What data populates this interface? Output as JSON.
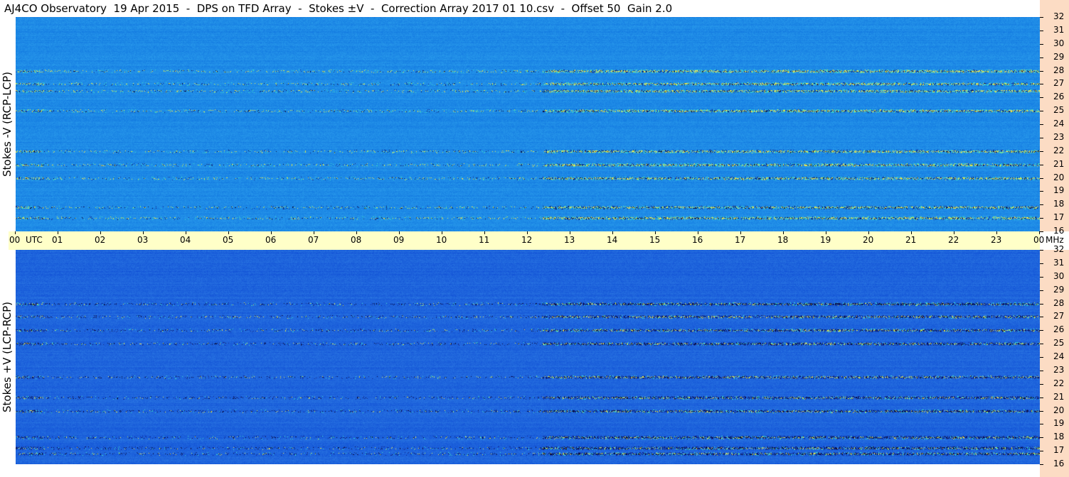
{
  "title": "AJ4CO Observatory  19 Apr 2015  -  DPS on TFD Array  -  Stokes ±V  -  Correction Array 2017 01 10.csv  -  Offset 50  Gain 2.0",
  "panels": [
    {
      "label": "Stokes -V (RCP-LCP)"
    },
    {
      "label": "Stokes +V (LCP-RCP)"
    }
  ],
  "colors": {
    "axis_bg": "#fcdcc4",
    "time_bar_bg": "#ffffc8",
    "panel_top_base": "#1e8ae6",
    "panel_bottom_base": "#1e64dc"
  },
  "chart_data": [
    {
      "type": "heatmap",
      "title": "Stokes -V (RCP-LCP)",
      "x_axis": {
        "unit": "UTC",
        "ticks": [
          "00",
          "01",
          "02",
          "03",
          "04",
          "05",
          "06",
          "07",
          "08",
          "09",
          "10",
          "11",
          "12",
          "13",
          "14",
          "15",
          "16",
          "17",
          "18",
          "19",
          "20",
          "21",
          "22",
          "23",
          "00"
        ],
        "range": [
          0,
          24
        ]
      },
      "y_axis": {
        "unit": "MHz",
        "ticks": [
          "16",
          "17",
          "18",
          "19",
          "20",
          "21",
          "22",
          "23",
          "24",
          "25",
          "26",
          "27",
          "28",
          "29",
          "30",
          "31",
          "32"
        ],
        "range": [
          16,
          32
        ]
      },
      "emission_bands_mhz": [
        17,
        17.8,
        20,
        21,
        22,
        25,
        26.5,
        27,
        28
      ]
    },
    {
      "type": "heatmap",
      "title": "Stokes +V (LCP-RCP)",
      "x_axis": {
        "unit": "UTC",
        "ticks": [
          "00",
          "01",
          "02",
          "03",
          "04",
          "05",
          "06",
          "07",
          "08",
          "09",
          "10",
          "11",
          "12",
          "13",
          "14",
          "15",
          "16",
          "17",
          "18",
          "19",
          "20",
          "21",
          "22",
          "23",
          "00"
        ],
        "range": [
          0,
          24
        ]
      },
      "y_axis": {
        "unit": "MHz",
        "ticks": [
          "16",
          "17",
          "18",
          "19",
          "20",
          "21",
          "22",
          "23",
          "24",
          "25",
          "26",
          "27",
          "28",
          "29",
          "30",
          "31",
          "32"
        ],
        "range": [
          16,
          32
        ]
      },
      "emission_bands_mhz": [
        16.8,
        17.2,
        18,
        20,
        21,
        22.5,
        25,
        26,
        27,
        28
      ]
    }
  ],
  "time_axis": {
    "labels": [
      "00",
      "UTC",
      "01",
      "02",
      "03",
      "04",
      "05",
      "06",
      "07",
      "08",
      "09",
      "10",
      "11",
      "12",
      "13",
      "14",
      "15",
      "16",
      "17",
      "18",
      "19",
      "20",
      "21",
      "22",
      "23",
      "00",
      "MHz"
    ]
  }
}
